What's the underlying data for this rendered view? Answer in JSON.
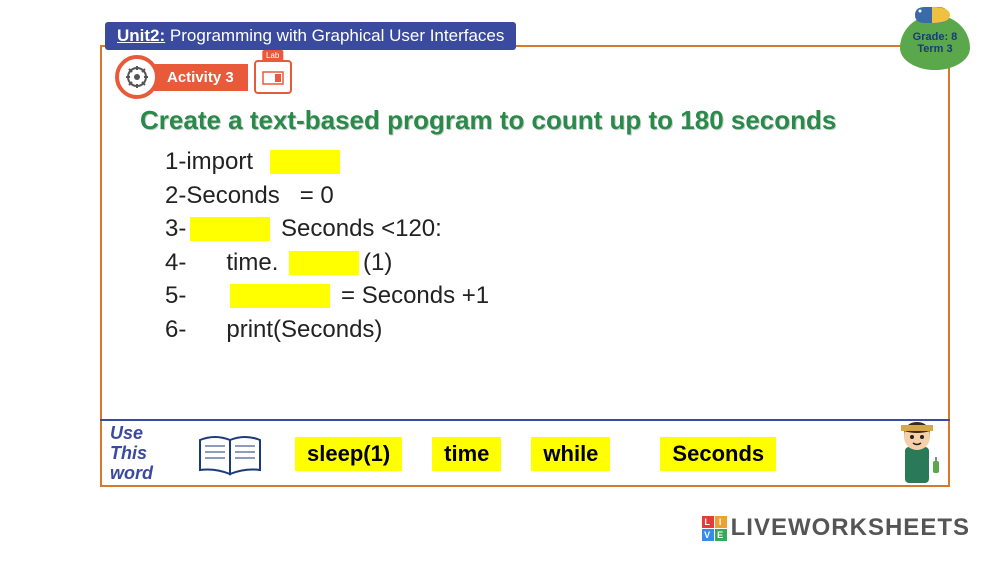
{
  "header": {
    "unit": "Unit2:",
    "title": "Programming with Graphical User Interfaces"
  },
  "badge": {
    "grade": "Grade: 8",
    "term": "Term 3"
  },
  "activity": {
    "label": "Activity 3",
    "lab": "Lab"
  },
  "task_title": "Create a text-based program to count up to 180 seconds",
  "code": {
    "l1a": "1-import  ",
    "l2": "2-Seconds   = 0",
    "l3a": "3-",
    "l3b": " Seconds <120:",
    "l4a": "4-      time. ",
    "l4b": "(1)",
    "l5a": "5-      ",
    "l5b": " = Seconds +1",
    "l6": "6-      print(Seconds)"
  },
  "word_bank": {
    "label_l1": "Use",
    "label_l2": "This",
    "label_l3": "word",
    "words": [
      "sleep(1)",
      "time",
      "while",
      "Seconds"
    ]
  },
  "watermark": "LIVEWORKSHEETS"
}
